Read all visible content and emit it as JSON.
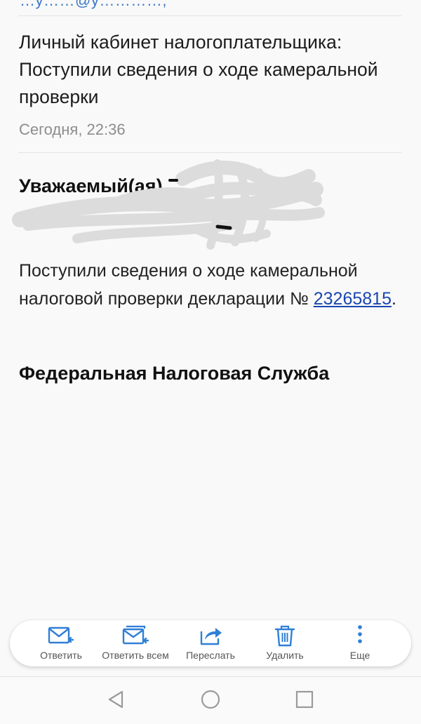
{
  "message": {
    "sender_partial": "…y……@y…………,",
    "subject": "Личный кабинет налогоплательщика: Поступили сведения о ходе камеральной проверки",
    "date": "Сегодня, 22:36",
    "greeting": "Уважаемый(ая)",
    "body_text": "Поступили сведения о ходе камеральной налоговой проверки декларации №",
    "declaration_number": "23265815",
    "body_end": ".",
    "signature": "Федеральная Налоговая Служба"
  },
  "actions": {
    "reply": "Ответить",
    "reply_all": "Ответить всем",
    "forward": "Переслать",
    "delete": "Удалить",
    "more": "Еще"
  },
  "nav": {
    "back_icon": "triangle-back-icon",
    "home_icon": "circle-home-icon",
    "recents_icon": "square-recents-icon"
  },
  "colors": {
    "accent": "#2f7fd6",
    "link": "#1a46b0",
    "muted_text": "#8d8d8d"
  }
}
